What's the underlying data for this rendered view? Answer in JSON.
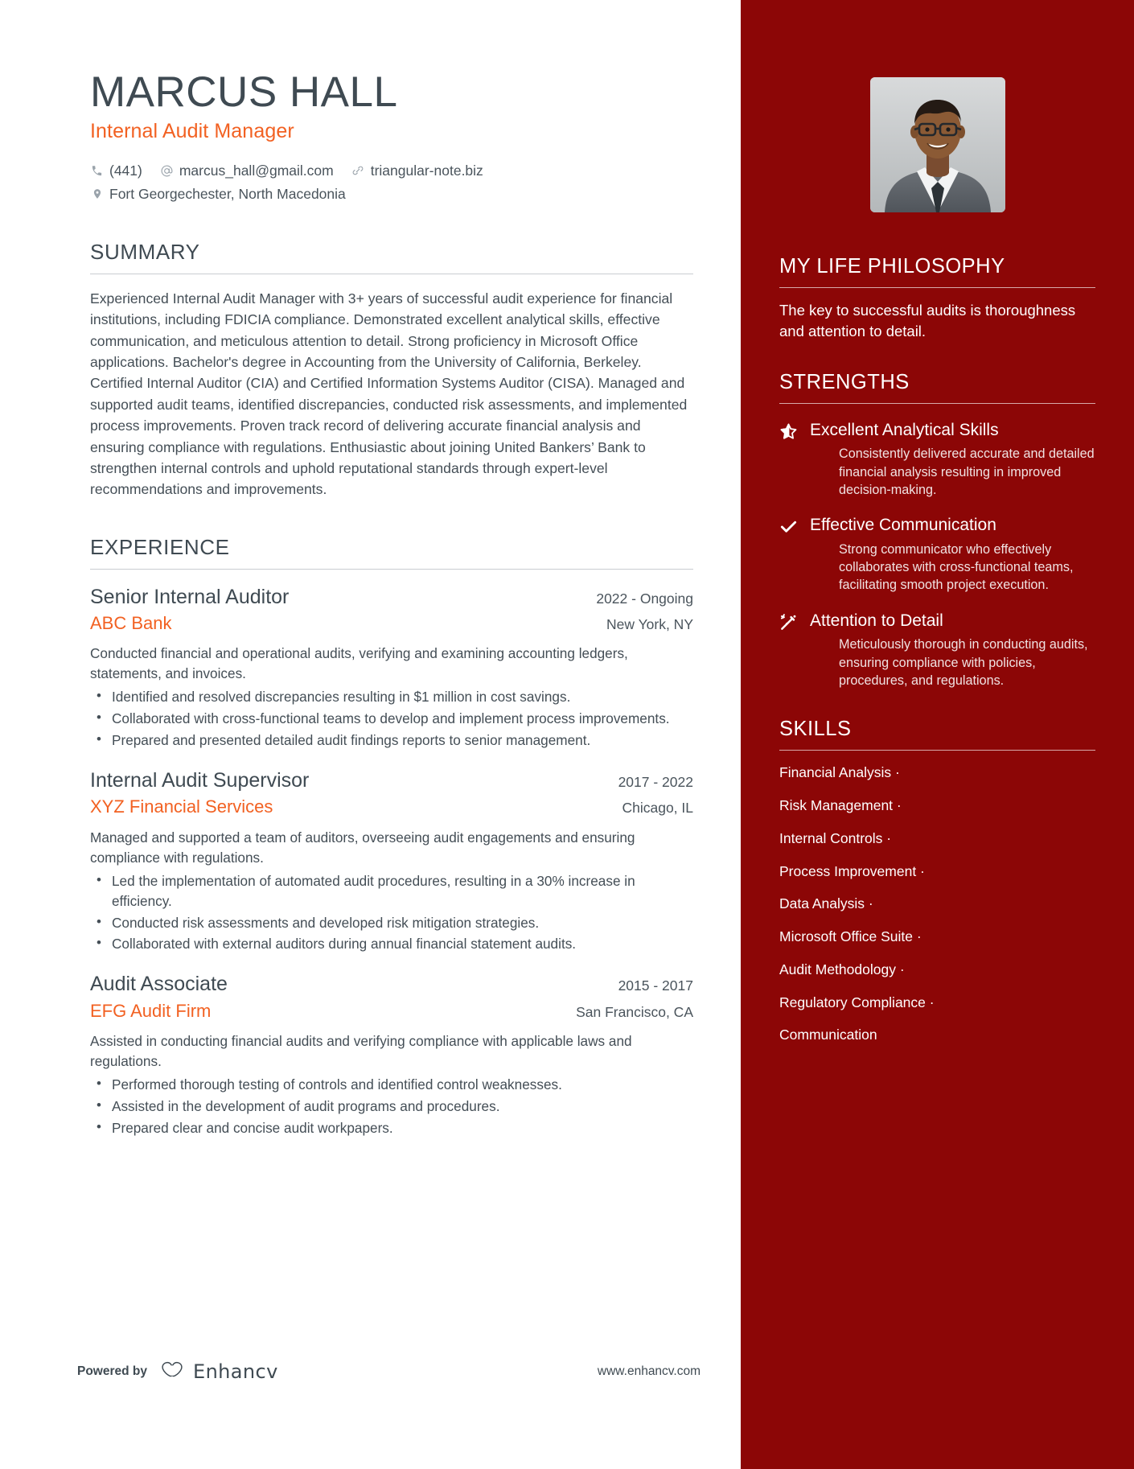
{
  "header": {
    "name": "MARCUS HALL",
    "job_title": "Internal Audit Manager",
    "contacts": [
      {
        "icon": "phone-icon",
        "text": "(441)"
      },
      {
        "icon": "at-sign-icon",
        "text": "marcus_hall@gmail.com"
      },
      {
        "icon": "link-icon",
        "text": "triangular-note.biz"
      }
    ],
    "location": {
      "icon": "map-pin-icon",
      "text": "Fort Georgechester, North Macedonia"
    }
  },
  "summary": {
    "title": "SUMMARY",
    "text": "Experienced Internal Audit Manager with 3+ years of successful audit experience for financial institutions, including FDICIA compliance. Demonstrated excellent analytical skills, effective communication, and meticulous attention to detail. Strong proficiency in Microsoft Office applications. Bachelor's degree in Accounting from the University of California, Berkeley. Certified Internal Auditor (CIA) and Certified Information Systems Auditor (CISA). Managed and supported audit teams, identified discrepancies, conducted risk assessments, and implemented process improvements. Proven track record of delivering accurate financial analysis and ensuring compliance with regulations. Enthusiastic about joining United Bankers’ Bank to strengthen internal controls and uphold reputational standards through expert-level recommendations and improvements."
  },
  "experience": {
    "title": "EXPERIENCE",
    "items": [
      {
        "role": "Senior Internal Auditor",
        "dates": "2022 - Ongoing",
        "company": "ABC Bank",
        "location": "New York, NY",
        "description": "Conducted financial and operational audits, verifying and examining accounting ledgers, statements, and invoices.",
        "bullets": [
          "Identified and resolved discrepancies resulting in $1 million in cost savings.",
          "Collaborated with cross-functional teams to develop and implement process improvements.",
          "Prepared and presented detailed audit findings reports to senior management."
        ]
      },
      {
        "role": "Internal Audit Supervisor",
        "dates": "2017 - 2022",
        "company": "XYZ Financial Services",
        "location": "Chicago, IL",
        "description": "Managed and supported a team of auditors, overseeing audit engagements and ensuring compliance with regulations.",
        "bullets": [
          "Led the implementation of automated audit procedures, resulting in a 30% increase in efficiency.",
          "Conducted risk assessments and developed risk mitigation strategies.",
          "Collaborated with external auditors during annual financial statement audits."
        ]
      },
      {
        "role": "Audit Associate",
        "dates": "2015 - 2017",
        "company": "EFG Audit Firm",
        "location": "San Francisco, CA",
        "description": "Assisted in conducting financial audits and verifying compliance with applicable laws and regulations.",
        "bullets": [
          "Performed thorough testing of controls and identified control weaknesses.",
          "Assisted in the development of audit programs and procedures.",
          "Prepared clear and concise audit workpapers."
        ]
      }
    ]
  },
  "footer": {
    "powered_by": "Powered by",
    "brand": "Enhancv",
    "url": "www.enhancv.com"
  },
  "sidebar": {
    "photo_alt": "profile-photo",
    "philosophy": {
      "title": "MY LIFE PHILOSOPHY",
      "text": "The key to successful audits is thoroughness and attention to detail."
    },
    "strengths": {
      "title": "STRENGTHS",
      "items": [
        {
          "icon": "half-star-icon",
          "name": "Excellent Analytical Skills",
          "description": "Consistently delivered accurate and detailed financial analysis resulting in improved decision-making."
        },
        {
          "icon": "check-icon",
          "name": "Effective Communication",
          "description": "Strong communicator who effectively collaborates with cross-functional teams, facilitating smooth project execution."
        },
        {
          "icon": "magic-wand-sparkle-icon",
          "name": "Attention to Detail",
          "description": "Meticulously thorough in conducting audits, ensuring compliance with policies, procedures, and regulations."
        }
      ]
    },
    "skills": {
      "title": "SKILLS",
      "items": [
        "Financial Analysis ·",
        "Risk Management ·",
        "Internal Controls ·",
        "Process Improvement ·",
        "Data Analysis ·",
        "Microsoft Office Suite ·",
        "Audit Methodology ·",
        "Regulatory Compliance ·",
        "Communication"
      ]
    }
  },
  "colors": {
    "sidebar_bg": "#8c0606",
    "accent_orange": "#f26122",
    "heading_gray": "#3f4a52",
    "body_gray": "#444e56"
  }
}
